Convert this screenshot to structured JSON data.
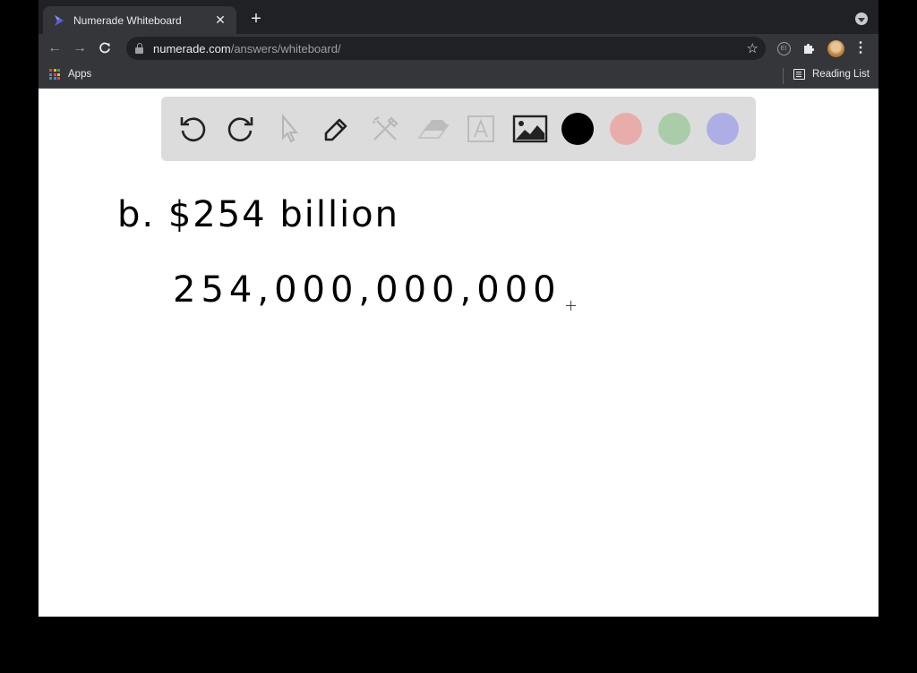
{
  "browser": {
    "tab_title": "Numerade Whiteboard",
    "tab_close_icon": "close-icon",
    "new_tab_label": "+",
    "url_domain": "numerade.com",
    "url_path": "/answers/whiteboard/",
    "bookmarks": {
      "apps_label": "Apps",
      "reading_list_label": "Reading List"
    },
    "extension_badge": "EI"
  },
  "whiteboard": {
    "tools": [
      {
        "name": "undo",
        "icon": "undo-icon",
        "enabled": true
      },
      {
        "name": "redo",
        "icon": "redo-icon",
        "enabled": true
      },
      {
        "name": "select",
        "icon": "cursor-icon",
        "enabled": false
      },
      {
        "name": "pen",
        "icon": "pencil-icon",
        "enabled": true,
        "selected": true
      },
      {
        "name": "tools",
        "icon": "wrench-hammer-icon",
        "enabled": false
      },
      {
        "name": "eraser",
        "icon": "eraser-icon",
        "enabled": false
      },
      {
        "name": "text",
        "icon": "text-icon",
        "enabled": false
      },
      {
        "name": "image",
        "icon": "image-icon",
        "enabled": true
      }
    ],
    "colors": [
      {
        "name": "black",
        "hex": "#000000"
      },
      {
        "name": "pink",
        "hex": "#e8adab"
      },
      {
        "name": "green",
        "hex": "#aacca9"
      },
      {
        "name": "purple",
        "hex": "#aeaee6"
      }
    ],
    "handwriting": {
      "line1": "b. $254 billion",
      "line2": "254,000,000,000"
    }
  }
}
